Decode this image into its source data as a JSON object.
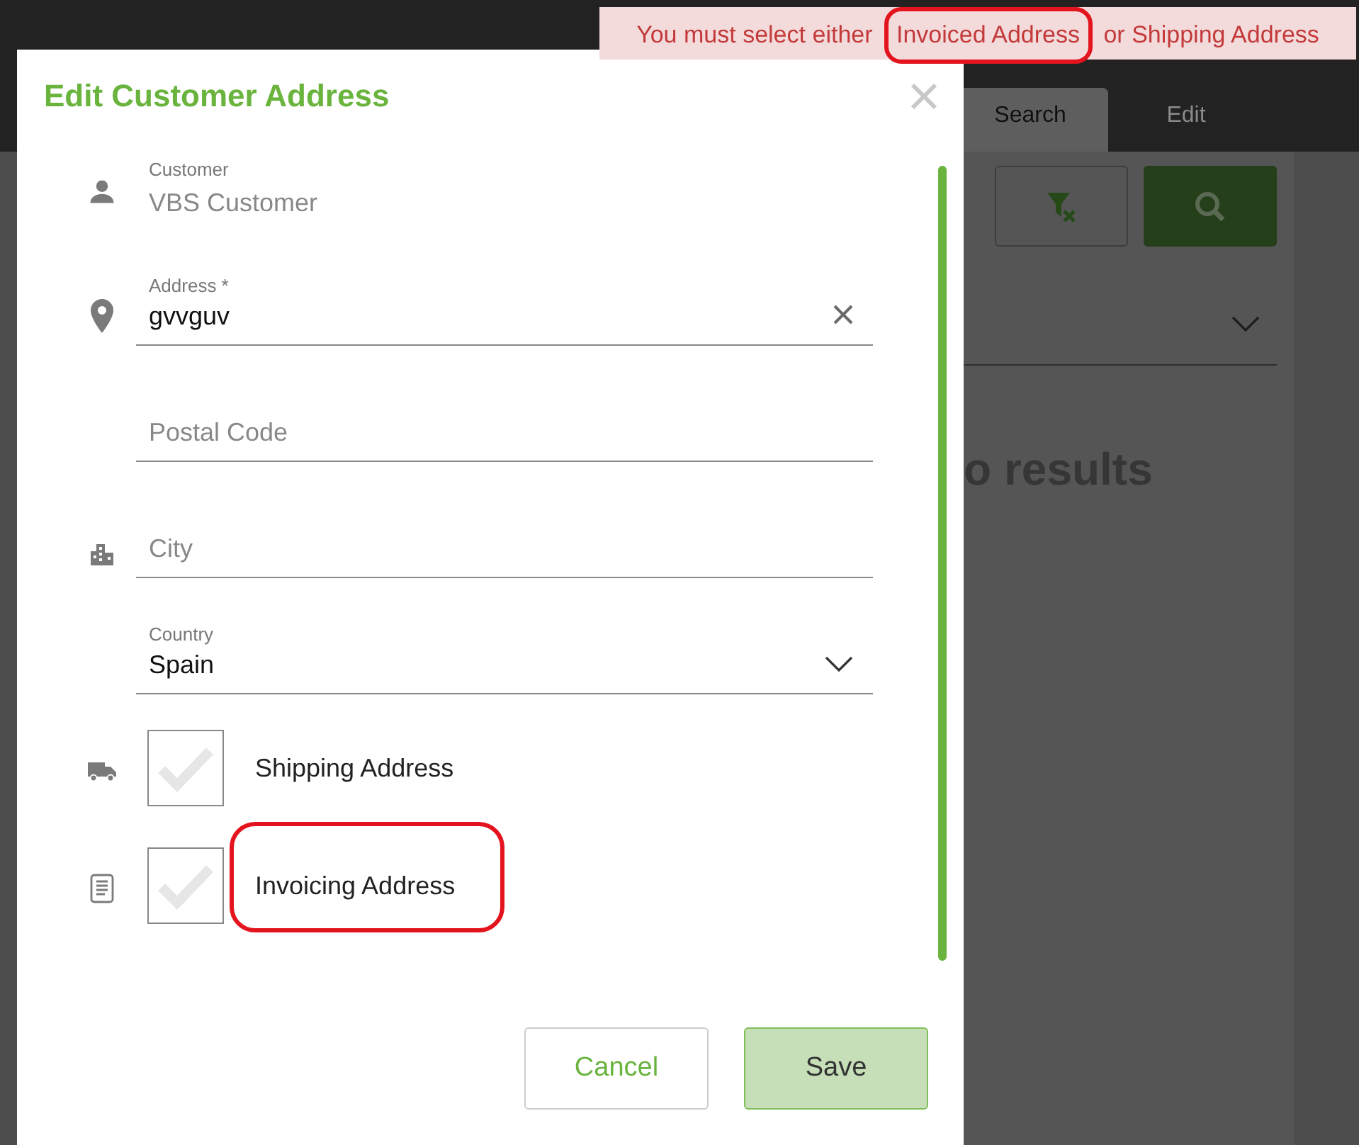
{
  "background": {
    "tabs": [
      {
        "label": "Search",
        "selected": true
      },
      {
        "label": "Edit",
        "selected": false
      }
    ],
    "results_text": "o results"
  },
  "toast": {
    "message": "You must select either Invoiced Address or Shipping Address"
  },
  "dialog": {
    "title": "Edit Customer Address",
    "fields": [
      {
        "kind": "readonly",
        "label": "Customer",
        "value": "VBS Customer"
      },
      {
        "kind": "text",
        "label": "Address *",
        "value": "gvvguv"
      },
      {
        "kind": "text",
        "placeholder": "Postal Code"
      },
      {
        "kind": "text",
        "placeholder": "City"
      },
      {
        "kind": "select",
        "label": "Country",
        "value": "Spain"
      }
    ],
    "checkboxes": [
      {
        "label": "Shipping Address",
        "checked": false
      },
      {
        "label": "Invoicing Address",
        "checked": false
      }
    ],
    "buttons": [
      {
        "label": "Cancel",
        "kind": "secondary"
      },
      {
        "label": "Save",
        "kind": "primary"
      }
    ]
  }
}
